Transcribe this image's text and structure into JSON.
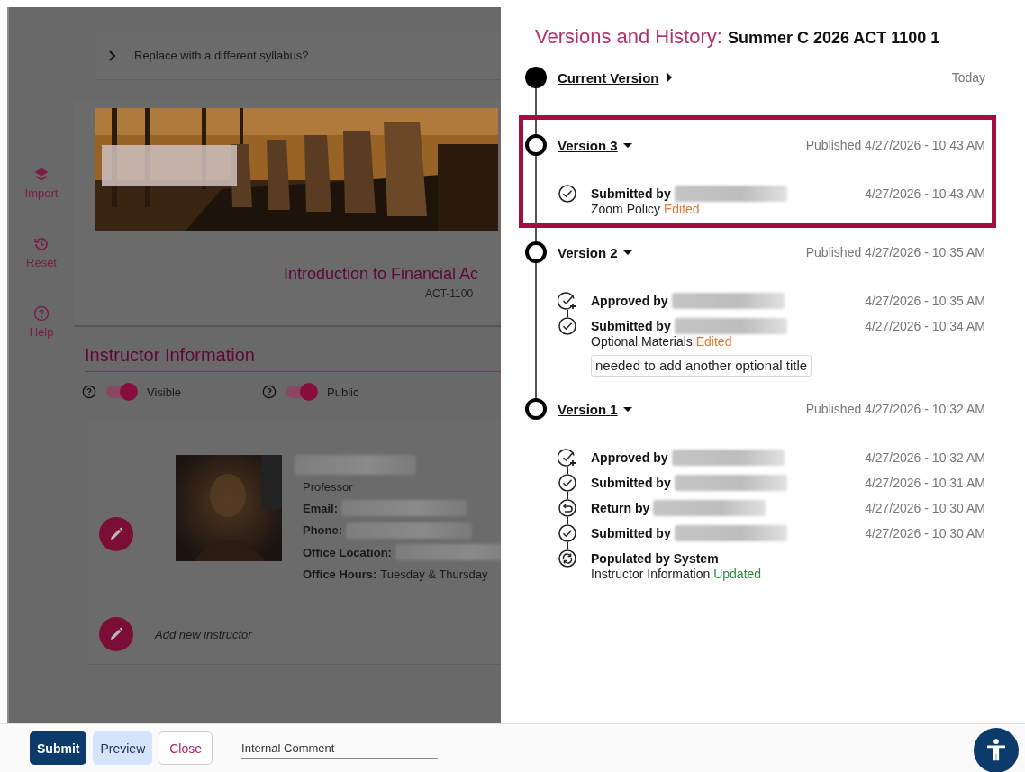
{
  "left_page": {
    "sidebar": [
      {
        "kind": "import",
        "label": "Import"
      },
      {
        "kind": "reset",
        "label": "Reset"
      },
      {
        "kind": "help",
        "label": "Help"
      }
    ],
    "replace_prompt": {
      "label": "Replace with a different syllabus?",
      "expanded": false
    },
    "course": {
      "title": "Introduction to Financial Ac",
      "code": "ACT-1100"
    },
    "section_title": "Instructor Information",
    "toggles": [
      {
        "label": "Visible",
        "on": true
      },
      {
        "label": "Public",
        "on": true
      }
    ],
    "instructor": {
      "role": "Professor",
      "fields": [
        {
          "label": "Email:"
        },
        {
          "label": "Phone:"
        },
        {
          "label": "Office Location:"
        },
        {
          "label": "Office Hours:",
          "value": "Tuesday & Thursday"
        }
      ]
    },
    "add_instructor": "Add new instructor"
  },
  "history_panel": {
    "title": "Versions and History:",
    "subtitle": "Summer C 2026 ACT 1100 1",
    "versions": [
      {
        "kind": "current",
        "title": "Current Version",
        "expanded": false,
        "highlighted": false,
        "date": "Today"
      },
      {
        "kind": "version",
        "title": "Version 3",
        "expanded": true,
        "highlighted": true,
        "date": "Published 4/27/2026 - 10:43 AM",
        "events": [
          {
            "kind": "submitted",
            "label": "Submitted by",
            "name_hidden": true,
            "time": "4/27/2026 - 10:43 AM",
            "detail": {
              "section": "Zoom Policy",
              "change": "Edited",
              "color": "#e07b39"
            }
          }
        ]
      },
      {
        "kind": "version",
        "title": "Version 2",
        "expanded": true,
        "highlighted": false,
        "date": "Published 4/27/2026 - 10:35 AM",
        "events": [
          {
            "kind": "approved",
            "label": "Approved by",
            "name_hidden": true,
            "time": "4/27/2026 - 10:35 AM"
          },
          {
            "kind": "submitted",
            "label": "Submitted by",
            "name_hidden": true,
            "time": "4/27/2026 - 10:34 AM",
            "detail": {
              "section": "Optional Materials",
              "change": "Edited",
              "color": "#e07b39"
            },
            "comment": "needed to add another optional title"
          }
        ]
      },
      {
        "kind": "version",
        "title": "Version 1",
        "expanded": true,
        "highlighted": false,
        "date": "Published 4/27/2026 - 10:32 AM",
        "events": [
          {
            "kind": "approved",
            "label": "Approved by",
            "name_hidden": true,
            "time": "4/27/2026 - 10:32 AM"
          },
          {
            "kind": "submitted",
            "label": "Submitted by",
            "name_hidden": true,
            "time": "4/27/2026 - 10:31 AM"
          },
          {
            "kind": "returned",
            "label": "Return by",
            "name_hidden": true,
            "time": "4/27/2026 - 10:30 AM"
          },
          {
            "kind": "submitted",
            "label": "Submitted by",
            "name_hidden": true,
            "time": "4/27/2026 - 10:30 AM"
          },
          {
            "kind": "populated",
            "label": "Populated by System",
            "name_hidden": false,
            "detail": {
              "section": "Instructor Information",
              "change": "Updated",
              "color": "#2e8b3e"
            }
          }
        ]
      }
    ]
  },
  "footer": {
    "buttons": [
      {
        "kind": "primary",
        "label": "Submit"
      },
      {
        "kind": "secondary",
        "label": "Preview"
      },
      {
        "kind": "outline",
        "label": "Close"
      }
    ],
    "comment": {
      "placeholder": "Internal Comment"
    }
  }
}
